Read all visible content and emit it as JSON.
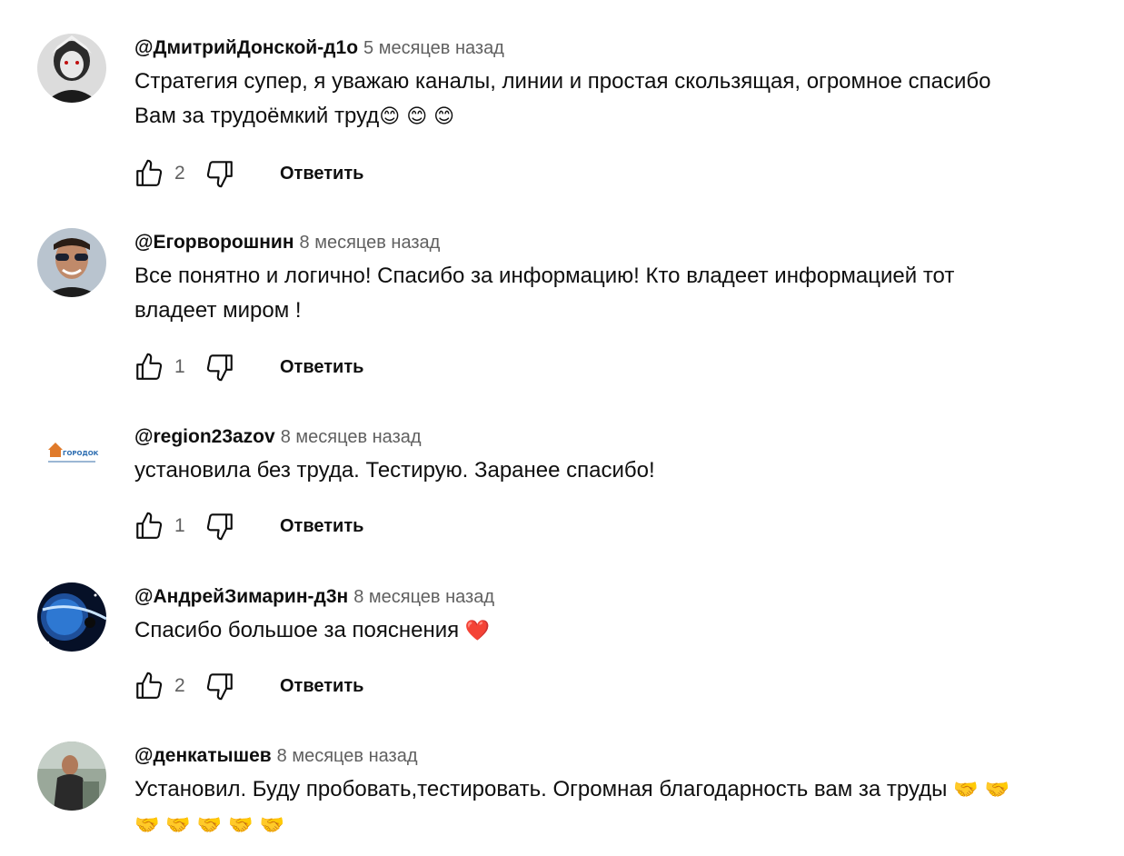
{
  "comments": [
    {
      "author": "@ДмитрийДонской-д1о",
      "time": "5 месяцев назад",
      "text_lines": [
        "Стратегия супер, я уважаю каналы, линии и простая скользящая, огромное спасибо",
        "Вам за трудоёмкий труд"
      ],
      "emoji": "😊 😊 😊",
      "likes": "2",
      "reply_label": "Ответить",
      "avatar_color": "#3a3a3a"
    },
    {
      "author": "@Егорворошнин",
      "time": "8 месяцев назад",
      "text_lines": [
        "Все понятно и логично! Спасибо за информацию! Кто владеет информацией тот",
        "владеет миром !"
      ],
      "emoji": "",
      "likes": "1",
      "reply_label": "Ответить",
      "avatar_color": "#8a6b5a"
    },
    {
      "author": "@region23azov",
      "time": "8 месяцев назад",
      "text_lines": [
        "установила без труда. Тестирую. Заранее спасибо!"
      ],
      "emoji": "",
      "likes": "1",
      "reply_label": "Ответить",
      "avatar_logo_text": "ГОРОДОК"
    },
    {
      "author": "@АндрейЗимарин-д3н",
      "time": "8 месяцев назад",
      "text_lines": [
        "Спасибо большое за пояснения"
      ],
      "emoji": "❤️",
      "likes": "2",
      "reply_label": "Ответить",
      "avatar_color": "#0a1a3a"
    },
    {
      "author": "@денкатышев",
      "time": "8 месяцев назад",
      "text_lines": [
        "Установил. Буду пробовать,тестировать. Огромная благодарность вам за труды"
      ],
      "emoji_inline": "🤝 🤝",
      "emoji_line2": "🤝 🤝 🤝 🤝 🤝",
      "reply_label": "",
      "avatar_color": "#5a6a5a"
    }
  ],
  "icons": {
    "like": "thumb-up-icon",
    "dislike": "thumb-down-icon"
  },
  "colors": {
    "text": "#0f0f0f",
    "secondary": "#606060",
    "background": "#ffffff"
  }
}
